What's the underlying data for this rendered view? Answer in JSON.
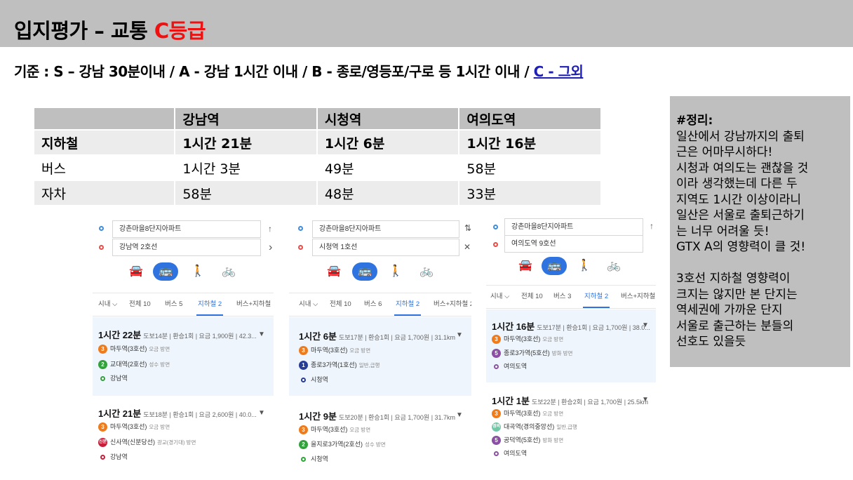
{
  "title": {
    "main": "입지평가 – 교통 ",
    "grade": "C등급"
  },
  "criteria": {
    "prefix": "기준 : S – 강남 30분이내 / A - 강남 1시간 이내 / B - 종로/영등포/구로 등 1시간 이내 / ",
    "c_text": "C - 그외"
  },
  "table": {
    "headers": [
      "",
      "강남역",
      "시청역",
      "여의도역"
    ],
    "rows": [
      [
        "지하철",
        "1시간 21분",
        "1시간 6분",
        "1시간 16분"
      ],
      [
        "버스",
        "1시간 3분",
        "49분",
        "58분"
      ],
      [
        "자차",
        "58분",
        "48분",
        "33분"
      ]
    ]
  },
  "note": {
    "title": "#정리:",
    "body": "일산에서 강남까지의 출퇴\n근은 어마무시하다!\n시청과 여의도는 괜찮을 것\n이라 생각했는데 다른 두\n지역도 1시간 이상이라니\n일산은 서울로 출퇴근하기\n는 너무 어려울 듯!\nGTX A의 영향력이 클 것!\n\n3호선 지하철 영향력이\n크지는 않지만 본 단지는\n역세권에 가까운 단지\n서울로 출근하는 분들의\n선호도 있을듯"
  },
  "colors": {
    "line3": "#ef7c1c",
    "line2": "#33a23d",
    "line1": "#263c96",
    "line5": "#8b50a4",
    "sinbundang": "#c81e3a",
    "gyeongui": "#72c7a6",
    "accent": "#2f73e0",
    "grade": "#ee1111",
    "link": "#1f1fb4"
  },
  "icons": {
    "car": "car-icon",
    "bus": "bus-icon",
    "walk": "walk-icon",
    "bike": "bike-icon",
    "swap": "swap-icon",
    "route_go": "chevron-right-icon",
    "close": "close-icon",
    "expand": "caret-down-icon"
  },
  "panels": [
    {
      "start": "강촌마을8단지아파트",
      "end": "강남역 2호선",
      "top_icon": "↑",
      "bottom_icon": "›",
      "tabs": [
        "시내 ⌵",
        "전체 10",
        "버스 5",
        "지하철 2",
        "버스+지하철"
      ],
      "routes": [
        {
          "time": "1시간 22분",
          "meta": "도보14분 | 환승1회 | 요금 1,900원 | 42.3...",
          "stops": [
            {
              "badge": "3",
              "color": "#ef7c1c",
              "name": "마두역(3호선)",
              "dir": "오금 방면"
            },
            {
              "badge": "2",
              "color": "#33a23d",
              "name": "교대역(2호선)",
              "dir": "성수 방면"
            },
            {
              "badge": "",
              "color": "#33a23d",
              "name": "강남역",
              "dir": ""
            }
          ]
        },
        {
          "time": "1시간 21분",
          "meta": "도보18분 | 환승1회 | 요금 2,600원 | 40.0...",
          "stops": [
            {
              "badge": "3",
              "color": "#ef7c1c",
              "name": "마두역(3호선)",
              "dir": "오금 방면"
            },
            {
              "badge": "신분",
              "color": "#c81e3a",
              "name": "신사역(신분당선)",
              "dir": "광교(경기대) 방면"
            },
            {
              "badge": "",
              "color": "#c81e3a",
              "name": "강남역",
              "dir": ""
            }
          ]
        }
      ]
    },
    {
      "start": "강촌마을8단지아파트",
      "end": "시청역 1호선",
      "top_icon": "⇅",
      "bottom_icon": "✕",
      "tabs": [
        "시내 ⌵",
        "전체 10",
        "버스 6",
        "지하철 2",
        "버스+지하철 2"
      ],
      "routes": [
        {
          "time": "1시간 6분",
          "meta": "도보17분 | 환승1회 | 요금 1,700원 | 31.1km",
          "stops": [
            {
              "badge": "3",
              "color": "#ef7c1c",
              "name": "마두역(3호선)",
              "dir": "오금 방면"
            },
            {
              "badge": "1",
              "color": "#263c96",
              "name": "종로3가역(1호선)",
              "dir": "일반,급행"
            },
            {
              "badge": "",
              "color": "#263c96",
              "name": "시청역",
              "dir": ""
            }
          ]
        },
        {
          "time": "1시간 9분",
          "meta": "도보20분 | 환승1회 | 요금 1,700원 | 31.7km",
          "stops": [
            {
              "badge": "3",
              "color": "#ef7c1c",
              "name": "마두역(3호선)",
              "dir": "오금 방면"
            },
            {
              "badge": "2",
              "color": "#33a23d",
              "name": "을지로3가역(2호선)",
              "dir": "성수 방면"
            },
            {
              "badge": "",
              "color": "#33a23d",
              "name": "시청역",
              "dir": ""
            }
          ]
        }
      ]
    },
    {
      "start": "강촌마을8단지아파트",
      "end": "여의도역 9호선",
      "top_icon": "↑",
      "bottom_icon": "",
      "tabs": [
        "시내 ⌵",
        "전체 10",
        "버스 3",
        "지하철 2",
        "버스+지하철"
      ],
      "routes": [
        {
          "time": "1시간 16분",
          "meta": "도보17분 | 환승1회 | 요금 1,700원 | 38.0...",
          "stops": [
            {
              "badge": "3",
              "color": "#ef7c1c",
              "name": "마두역(3호선)",
              "dir": "오금 방면"
            },
            {
              "badge": "5",
              "color": "#8b50a4",
              "name": "종로3가역(5호선)",
              "dir": "방화 방면"
            },
            {
              "badge": "",
              "color": "#8b50a4",
              "name": "여의도역",
              "dir": ""
            }
          ]
        },
        {
          "time": "1시간 1분",
          "meta": "도보22분 | 환승2회 | 요금 1,700원 | 25.5km",
          "stops": [
            {
              "badge": "3",
              "color": "#ef7c1c",
              "name": "마두역(3호선)",
              "dir": "오금 방면"
            },
            {
              "badge": "경의",
              "color": "#72c7a6",
              "name": "대곡역(경의중앙선)",
              "dir": "일반,급행"
            },
            {
              "badge": "5",
              "color": "#8b50a4",
              "name": "공덕역(5호선)",
              "dir": "방화 방면"
            },
            {
              "badge": "",
              "color": "#8b50a4",
              "name": "여의도역",
              "dir": ""
            }
          ]
        }
      ]
    }
  ]
}
